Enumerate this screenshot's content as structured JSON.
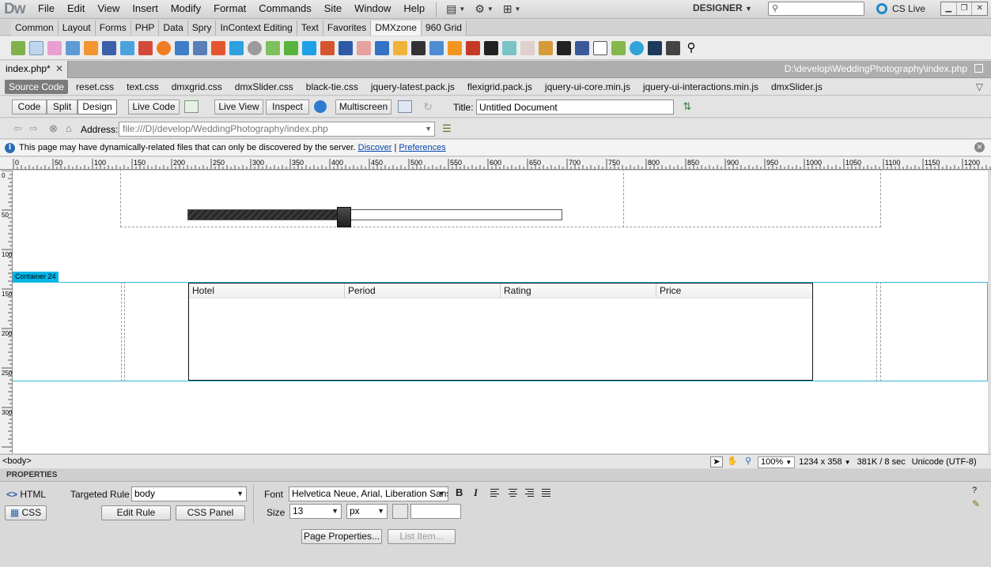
{
  "app": {
    "logo": "Dw",
    "menu": [
      "File",
      "Edit",
      "View",
      "Insert",
      "Modify",
      "Format",
      "Commands",
      "Site",
      "Window",
      "Help"
    ],
    "workspace": "DESIGNER",
    "cs_live": "CS Live"
  },
  "insert_bar": {
    "tabs": [
      "Common",
      "Layout",
      "Forms",
      "PHP",
      "Data",
      "Spry",
      "InContext Editing",
      "Text",
      "Favorites",
      "DMXzone",
      "960 Grid"
    ],
    "active_tab": "DMXzone"
  },
  "document": {
    "tab_label": "index.php*",
    "file_path": "D:\\develop\\WeddingPhotography\\index.php",
    "related_files": [
      "Source Code",
      "reset.css",
      "text.css",
      "dmxgrid.css",
      "dmxSlider.css",
      "black-tie.css",
      "jquery-latest.pack.js",
      "flexigrid.pack.js",
      "jquery-ui-core.min.js",
      "jquery-ui-interactions.min.js",
      "dmxSlider.js"
    ]
  },
  "toolbar": {
    "code": "Code",
    "split": "Split",
    "design": "Design",
    "live_code": "Live Code",
    "live_view": "Live View",
    "inspect": "Inspect",
    "multiscreen": "Multiscreen",
    "title_label": "Title:",
    "title_value": "Untitled Document"
  },
  "nav": {
    "address_label": "Address:",
    "address_value": "file:///D|/develop/WeddingPhotography/index.php"
  },
  "info_bar": {
    "message": "This page may have dynamically-related files that can only be discovered by the server.",
    "discover": "Discover",
    "separator": "|",
    "preferences": "Preferences"
  },
  "rulers": {
    "h_ticks": [
      "0",
      "50",
      "100",
      "150",
      "200",
      "250",
      "300",
      "350",
      "400",
      "450",
      "500",
      "550",
      "600",
      "650",
      "700",
      "750",
      "800",
      "850",
      "900",
      "950",
      "1000",
      "1050",
      "1100",
      "1150",
      "1200"
    ],
    "v_ticks": [
      "0",
      "50",
      "100",
      "150",
      "200",
      "250",
      "300"
    ]
  },
  "canvas": {
    "slider_value_fraction": 0.42,
    "container_label": "Container 24",
    "grid_columns": [
      "Hotel",
      "Period",
      "Rating",
      "Price"
    ]
  },
  "status": {
    "tag": "<body>",
    "zoom": "100%",
    "dimensions": "1234 x 358",
    "download": "381K / 8 sec",
    "encoding": "Unicode (UTF-8)"
  },
  "properties": {
    "header": "PROPERTIES",
    "html_btn": "HTML",
    "css_btn": "CSS",
    "targeted_rule_label": "Targeted Rule",
    "targeted_rule_value": "body",
    "edit_rule": "Edit Rule",
    "css_panel": "CSS Panel",
    "font_label": "Font",
    "font_value": "Helvetica Neue, Arial, Liberation Sans",
    "size_label": "Size",
    "size_value": "13",
    "unit_value": "px",
    "bold": "B",
    "italic": "I",
    "page_properties": "Page Properties...",
    "list_item": "List Item..."
  }
}
